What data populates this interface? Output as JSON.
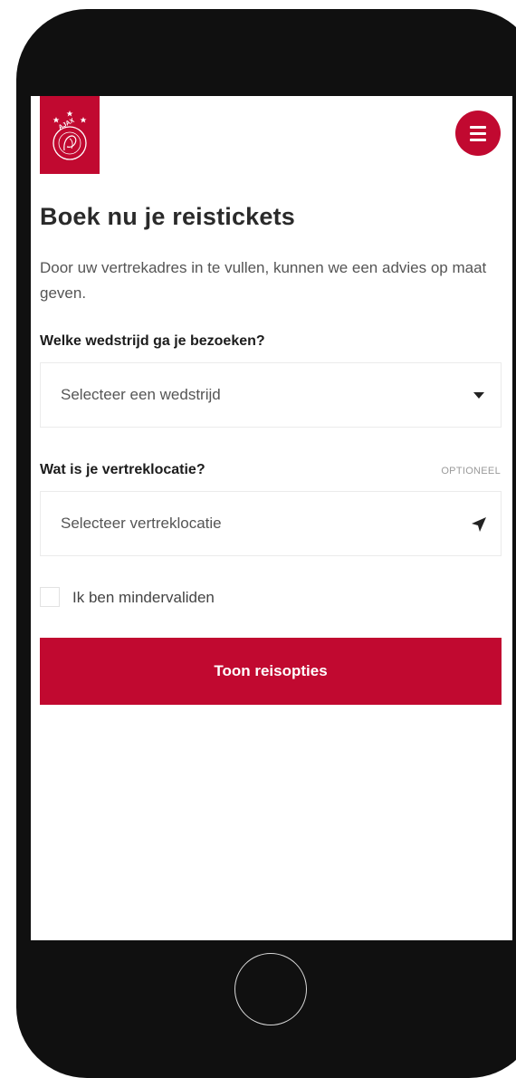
{
  "header": {
    "logo_icon": "ajax-crest-icon",
    "logo_text": "AJAX",
    "menu_icon": "hamburger-menu-icon"
  },
  "main": {
    "title": "Boek nu je reistickets",
    "intro": "Door uw vertrekadres in te vullen, kunnen we een advies op maat geven.",
    "match_field": {
      "label": "Welke wedstrijd ga je bezoeken?",
      "value": "Selecteer een wedstrijd",
      "icon": "caret-down-icon"
    },
    "location_field": {
      "label": "Wat is je vertreklocatie?",
      "optional": "OPTIONEEL",
      "value": "Selecteer vertreklocatie",
      "icon": "location-arrow-icon"
    },
    "disabled_checkbox": {
      "label": "Ik ben mindervaliden",
      "checked": false
    },
    "submit_label": "Toon reisopties"
  },
  "colors": {
    "brand_red": "#c10930",
    "phone_frame": "#101010",
    "text_dark": "#2a2a2a",
    "text_muted": "#555555"
  }
}
